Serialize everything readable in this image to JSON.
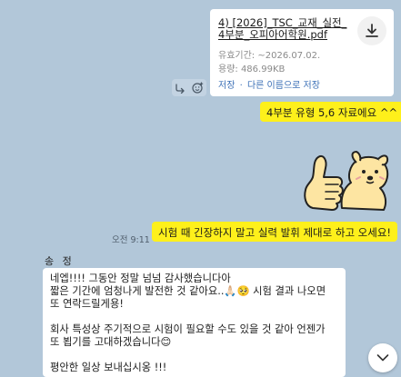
{
  "file_message": {
    "file_name": "4) [2026]_TSC_교재_실전_\n4부분_오피아어학원.pdf",
    "expiry": "유효기간: ~2026.07.02.",
    "size": "용량: 486.99KB",
    "save_label": "저장",
    "separator": "·",
    "save_as_label": "다른 이름으로 저장"
  },
  "messages": {
    "mine_1": "4부분 유형 5,6 자료에요 ^^",
    "mine_2": "시험 때 긴장하지 말고 실력 발휘 제대로 하고 오세요!",
    "mine_2_time": "오전 9:11"
  },
  "incoming": {
    "sender": "송 정",
    "lines": [
      "네엡!!!! 그동안 정말 넘넘 감사했습니다아",
      "짧은 기간에 엄청나게 발전한 것 같아요..🙏🏻🥺 시험 결과 나오면",
      "또 연락드릴게용!",
      "",
      "회사 특성상 주기적으로 시험이 필요할 수도 있을 것 같아 언젠가",
      "또 뵙기를 고대하겠습니다😊",
      "",
      "평안한 일상 보내십시옹 !!!"
    ]
  },
  "icons": {
    "download": "download-icon",
    "share": "share-icon",
    "reaction": "add-reaction-icon",
    "sticker": "thumbs-up-dog-sticker",
    "scroll": "chevron-down-icon"
  },
  "colors": {
    "background": "#b2c7d9",
    "my_bubble": "#fef01b",
    "their_bubble": "#ffffff",
    "link": "#3b6fb6"
  }
}
